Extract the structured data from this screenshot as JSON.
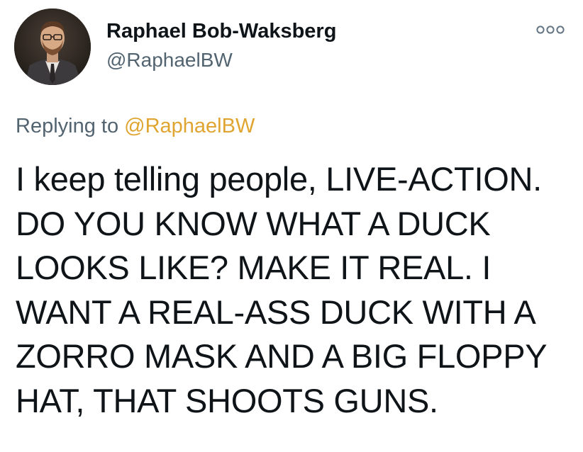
{
  "author": {
    "display_name": "Raphael Bob-Waksberg",
    "handle": "@RaphaelBW"
  },
  "more_button": {
    "icon": "more-options-icon"
  },
  "reply_context": {
    "prefix": "Replying to",
    "handle": "@RaphaelBW",
    "handle_color": "#e0a530"
  },
  "tweet": {
    "lines": [
      "I keep telling people, LIVE-ACTION.",
      "DO YOU KNOW WHAT A DUCK",
      "LOOKS LIKE? MAKE IT REAL. I",
      "WANT A REAL-ASS DUCK WITH A",
      "ZORRO MASK AND A BIG FLOPPY",
      "HAT, THAT SHOOTS GUNS."
    ]
  },
  "colors": {
    "text_primary": "#0f1419",
    "text_secondary": "#536471",
    "background": "#ffffff"
  }
}
